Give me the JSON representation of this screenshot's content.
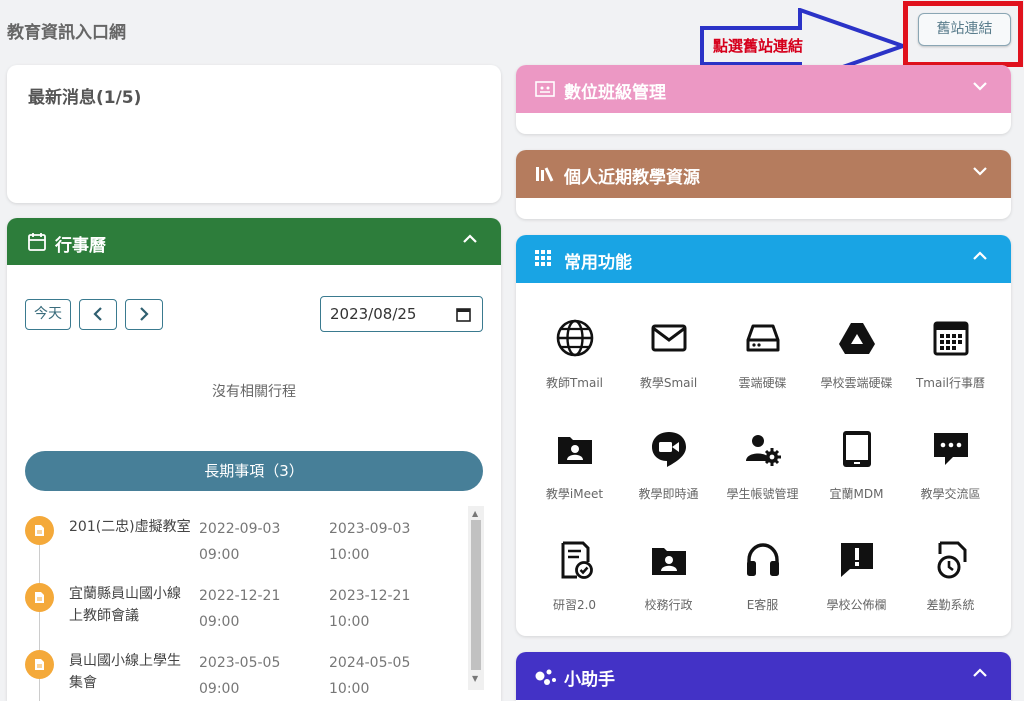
{
  "header": {
    "site_title": "教育資訊入口網",
    "old_site_button": "舊站連結"
  },
  "annotation": {
    "text": "點選舊站連結"
  },
  "news": {
    "title": "最新消息(1/5)"
  },
  "calendar": {
    "title": "行事曆",
    "today_label": "今天",
    "prev_symbol": "‹",
    "next_symbol": "›",
    "date_value": "2023/08/25",
    "no_events": "沒有相關行程",
    "long_term_button": "長期事項（3）",
    "events": [
      {
        "name": "201(二忠)虛擬教室",
        "start_date": "2022-09-03",
        "start_time": "09:00",
        "end_date": "2023-09-03",
        "end_time": "10:00"
      },
      {
        "name": "宜蘭縣員山國小線上教師會議",
        "start_date": "2022-12-21",
        "start_time": "09:00",
        "end_date": "2023-12-21",
        "end_time": "10:00"
      },
      {
        "name": "員山國小線上學生集會",
        "start_date": "2023-05-05",
        "start_time": "09:00",
        "end_date": "2024-05-05",
        "end_time": "10:00"
      }
    ]
  },
  "panels": {
    "class_mgmt": {
      "title": "數位班級管理",
      "color": "#ec98c4"
    },
    "personal_resources": {
      "title": "個人近期教學資源",
      "color": "#b57c5e"
    },
    "common": {
      "title": "常用功能",
      "color": "#19a4e4"
    },
    "assistant": {
      "title": "小助手",
      "color": "#4332c6"
    }
  },
  "functions": [
    {
      "label": "教師Tmail",
      "icon": "globe-icon"
    },
    {
      "label": "教學Smail",
      "icon": "mail-icon"
    },
    {
      "label": "雲端硬碟",
      "icon": "hard-drive-icon"
    },
    {
      "label": "學校雲端硬碟",
      "icon": "google-drive-icon"
    },
    {
      "label": "Tmail行事曆",
      "icon": "calendar-grid-icon"
    },
    {
      "label": "教學iMeet",
      "icon": "shared-folder-icon"
    },
    {
      "label": "教學即時通",
      "icon": "video-chat-icon"
    },
    {
      "label": "學生帳號管理",
      "icon": "user-settings-icon"
    },
    {
      "label": "宜蘭MDM",
      "icon": "tablet-icon"
    },
    {
      "label": "教學交流區",
      "icon": "chat-bubble-icon"
    },
    {
      "label": "研習2.0",
      "icon": "certificate-icon"
    },
    {
      "label": "校務行政",
      "icon": "shared-folder-icon"
    },
    {
      "label": "E客服",
      "icon": "headset-icon"
    },
    {
      "label": "學校公佈欄",
      "icon": "alert-message-icon"
    },
    {
      "label": "差勤系統",
      "icon": "document-clock-icon"
    }
  ]
}
